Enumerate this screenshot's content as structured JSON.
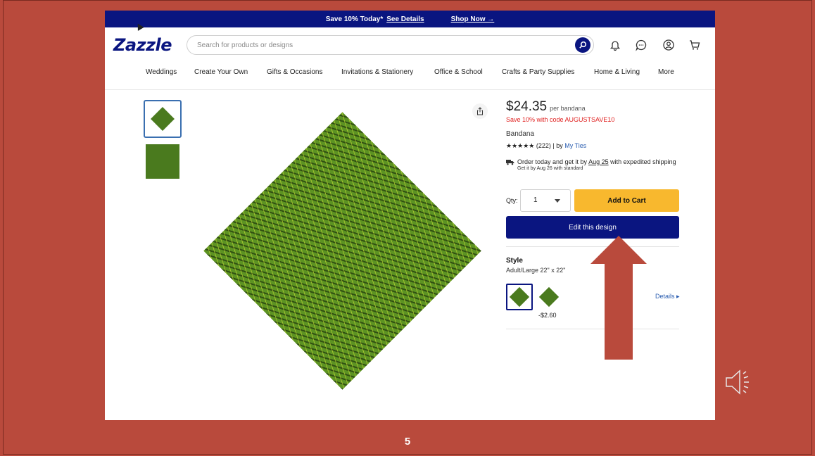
{
  "promo_bar": {
    "text": "Save 10% Today*",
    "details_link": "See Details",
    "shop_link": "Shop Now →"
  },
  "header": {
    "logo": "Zazzle",
    "search_placeholder": "Search for products or designs",
    "icons": [
      "search-icon",
      "bell-icon",
      "chat-icon",
      "account-icon",
      "cart-icon"
    ]
  },
  "nav": {
    "items": [
      "Weddings",
      "Create Your Own",
      "Gifts & Occasions",
      "Invitations & Stationery",
      "Office & School",
      "Crafts & Party Supplies",
      "Home & Living",
      "More"
    ]
  },
  "product": {
    "price": "$24.35",
    "per_unit": "per bandana",
    "promo_code_text": "Save 10% with code AUGUSTSAVE10",
    "name": "Bandana",
    "rating": "★★★★★ (222) | by",
    "seller": "My Ties",
    "shipping_prefix": "Order today and get it by",
    "shipping_date": "Aug 25",
    "shipping_suffix": "with expedited shipping",
    "standard_shipping": "Get it by Aug 26 with standard",
    "qty_label": "Qty:",
    "qty_value": "1",
    "add_to_cart": "Add to Cart",
    "edit_design": "Edit this design",
    "style_heading": "Style",
    "style_value": "Adult/Large 22\" x 22\"",
    "option_2_price": "-$2.60",
    "details_link": "Details ▸"
  },
  "slide": {
    "number": "5"
  },
  "colors": {
    "slide_background": "#b94a3c",
    "brand_navy": "#0a1580",
    "cart_button": "#f8b82e",
    "promo_red": "#e0201f",
    "bandana_green": "#5d9322",
    "annotation_arrow": "#b94a3c"
  }
}
